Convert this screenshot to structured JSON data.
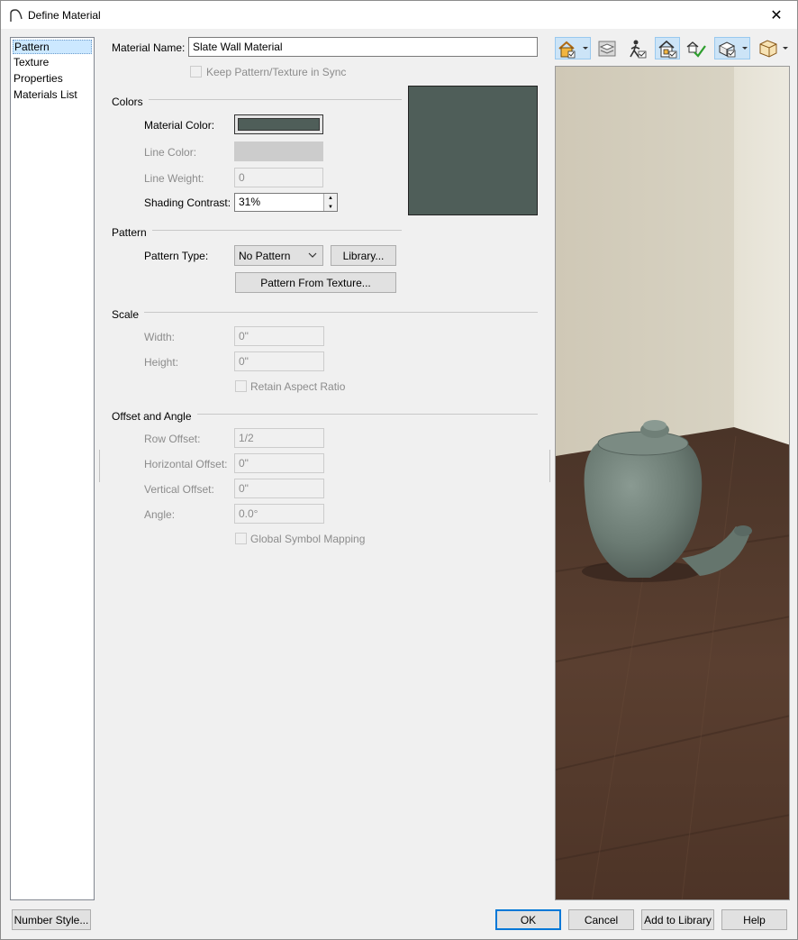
{
  "window": {
    "title": "Define Material",
    "close_symbol": "✕"
  },
  "nav": {
    "items": [
      {
        "label": "Pattern",
        "selected": true
      },
      {
        "label": "Texture",
        "selected": false
      },
      {
        "label": "Properties",
        "selected": false
      },
      {
        "label": "Materials List",
        "selected": false
      }
    ]
  },
  "material_name": {
    "label": "Material Name:",
    "value": "Slate Wall Material"
  },
  "keep_sync": {
    "label": "Keep Pattern/Texture in Sync",
    "checked": false
  },
  "colors": {
    "title": "Colors",
    "material_color_label": "Material Color:",
    "material_color": "#4f5e59",
    "line_color_label": "Line Color:",
    "line_color": "#cccccc",
    "line_weight_label": "Line Weight:",
    "line_weight_value": "0",
    "shading_contrast_label": "Shading Contrast:",
    "shading_contrast_value": "31%",
    "preview_color": "#4f5e59"
  },
  "pattern": {
    "title": "Pattern",
    "type_label": "Pattern Type:",
    "type_value": "No Pattern",
    "library_button": "Library...",
    "from_texture_button": "Pattern From Texture..."
  },
  "scale": {
    "title": "Scale",
    "width_label": "Width:",
    "width_value": "0\"",
    "height_label": "Height:",
    "height_value": "0\"",
    "retain_aspect_label": "Retain Aspect Ratio"
  },
  "offset": {
    "title": "Offset and Angle",
    "row_offset_label": "Row Offset:",
    "row_offset_value": "1/2",
    "horizontal_offset_label": "Horizontal Offset:",
    "horizontal_offset_value": "0\"",
    "vertical_offset_label": "Vertical Offset:",
    "vertical_offset_value": "0\"",
    "angle_label": "Angle:",
    "angle_value": "0.0°",
    "global_mapping_label": "Global Symbol Mapping"
  },
  "toolbar": {
    "icons": [
      "render-house-icon",
      "layers-icon",
      "person-walk-icon",
      "house-check-icon",
      "house-green-check-icon",
      "object-sphere-icon",
      "box-view-icon"
    ]
  },
  "footer": {
    "number_style": "Number Style...",
    "ok": "OK",
    "cancel": "Cancel",
    "add_to_library": "Add to Library",
    "help": "Help"
  }
}
